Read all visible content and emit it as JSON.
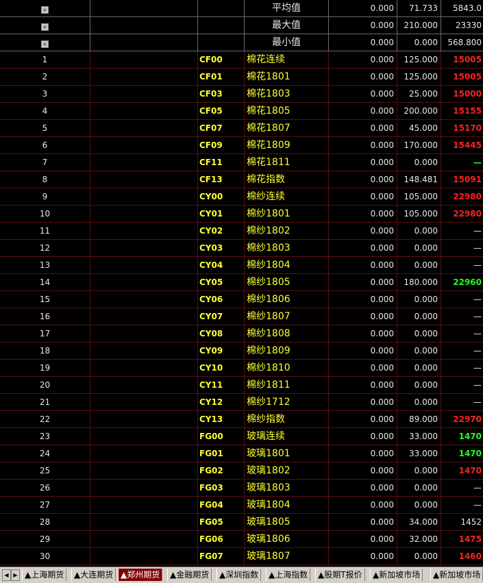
{
  "stats": [
    {
      "label": "平均值",
      "v1": "0.000",
      "v2": "71.733",
      "v3": "5843.0"
    },
    {
      "label": "最大值",
      "v1": "0.000",
      "v2": "210.000",
      "v3": "23330"
    },
    {
      "label": "最小值",
      "v1": "0.000",
      "v2": "0.000",
      "v3": "568.800"
    }
  ],
  "rows": [
    {
      "no": "1",
      "code": "CF00",
      "name": "棉花连续",
      "v1": "0.000",
      "v2": "125.000",
      "v3": "15005",
      "color": "red"
    },
    {
      "no": "2",
      "code": "CF01",
      "name": "棉花1801",
      "v1": "0.000",
      "v2": "125.000",
      "v3": "15005",
      "color": "red"
    },
    {
      "no": "3",
      "code": "CF03",
      "name": "棉花1803",
      "v1": "0.000",
      "v2": "25.000",
      "v3": "15000",
      "color": "red"
    },
    {
      "no": "4",
      "code": "CF05",
      "name": "棉花1805",
      "v1": "0.000",
      "v2": "200.000",
      "v3": "15155",
      "color": "red"
    },
    {
      "no": "5",
      "code": "CF07",
      "name": "棉花1807",
      "v1": "0.000",
      "v2": "45.000",
      "v3": "15170",
      "color": "red"
    },
    {
      "no": "6",
      "code": "CF09",
      "name": "棉花1809",
      "v1": "0.000",
      "v2": "170.000",
      "v3": "15445",
      "color": "red"
    },
    {
      "no": "7",
      "code": "CF11",
      "name": "棉花1811",
      "v1": "0.000",
      "v2": "0.000",
      "v3": "—",
      "color": "green"
    },
    {
      "no": "8",
      "code": "CF13",
      "name": "棉花指数",
      "v1": "0.000",
      "v2": "148.481",
      "v3": "15091",
      "color": "red"
    },
    {
      "no": "9",
      "code": "CY00",
      "name": "棉纱连续",
      "v1": "0.000",
      "v2": "105.000",
      "v3": "22980",
      "color": "red"
    },
    {
      "no": "10",
      "code": "CY01",
      "name": "棉纱1801",
      "v1": "0.000",
      "v2": "105.000",
      "v3": "22980",
      "color": "red"
    },
    {
      "no": "11",
      "code": "CY02",
      "name": "棉纱1802",
      "v1": "0.000",
      "v2": "0.000",
      "v3": "—",
      "color": "white"
    },
    {
      "no": "12",
      "code": "CY03",
      "name": "棉纱1803",
      "v1": "0.000",
      "v2": "0.000",
      "v3": "—",
      "color": "white"
    },
    {
      "no": "13",
      "code": "CY04",
      "name": "棉纱1804",
      "v1": "0.000",
      "v2": "0.000",
      "v3": "—",
      "color": "white"
    },
    {
      "no": "14",
      "code": "CY05",
      "name": "棉纱1805",
      "v1": "0.000",
      "v2": "180.000",
      "v3": "22960",
      "color": "green"
    },
    {
      "no": "15",
      "code": "CY06",
      "name": "棉纱1806",
      "v1": "0.000",
      "v2": "0.000",
      "v3": "—",
      "color": "white"
    },
    {
      "no": "16",
      "code": "CY07",
      "name": "棉纱1807",
      "v1": "0.000",
      "v2": "0.000",
      "v3": "—",
      "color": "white"
    },
    {
      "no": "17",
      "code": "CY08",
      "name": "棉纱1808",
      "v1": "0.000",
      "v2": "0.000",
      "v3": "—",
      "color": "white"
    },
    {
      "no": "18",
      "code": "CY09",
      "name": "棉纱1809",
      "v1": "0.000",
      "v2": "0.000",
      "v3": "—",
      "color": "white"
    },
    {
      "no": "19",
      "code": "CY10",
      "name": "棉纱1810",
      "v1": "0.000",
      "v2": "0.000",
      "v3": "—",
      "color": "white"
    },
    {
      "no": "20",
      "code": "CY11",
      "name": "棉纱1811",
      "v1": "0.000",
      "v2": "0.000",
      "v3": "—",
      "color": "white"
    },
    {
      "no": "21",
      "code": "CY12",
      "name": "棉纱1712",
      "v1": "0.000",
      "v2": "0.000",
      "v3": "—",
      "color": "white"
    },
    {
      "no": "22",
      "code": "CY13",
      "name": "棉纱指数",
      "v1": "0.000",
      "v2": "89.000",
      "v3": "22970",
      "color": "red"
    },
    {
      "no": "23",
      "code": "FG00",
      "name": "玻璃连续",
      "v1": "0.000",
      "v2": "33.000",
      "v3": "1470",
      "color": "green"
    },
    {
      "no": "24",
      "code": "FG01",
      "name": "玻璃1801",
      "v1": "0.000",
      "v2": "33.000",
      "v3": "1470",
      "color": "green"
    },
    {
      "no": "25",
      "code": "FG02",
      "name": "玻璃1802",
      "v1": "0.000",
      "v2": "0.000",
      "v3": "1470",
      "color": "red"
    },
    {
      "no": "26",
      "code": "FG03",
      "name": "玻璃1803",
      "v1": "0.000",
      "v2": "0.000",
      "v3": "—",
      "color": "white"
    },
    {
      "no": "27",
      "code": "FG04",
      "name": "玻璃1804",
      "v1": "0.000",
      "v2": "0.000",
      "v3": "—",
      "color": "white"
    },
    {
      "no": "28",
      "code": "FG05",
      "name": "玻璃1805",
      "v1": "0.000",
      "v2": "34.000",
      "v3": "1452",
      "color": "white"
    },
    {
      "no": "29",
      "code": "FG06",
      "name": "玻璃1806",
      "v1": "0.000",
      "v2": "32.000",
      "v3": "1475",
      "color": "red"
    },
    {
      "no": "30",
      "code": "FG07",
      "name": "玻璃1807",
      "v1": "0.000",
      "v2": "0.000",
      "v3": "1460",
      "color": "red"
    }
  ],
  "tabs": [
    {
      "label": "▲上海期货",
      "active": false
    },
    {
      "label": "▲大连期货",
      "active": false
    },
    {
      "label": "▲郑州期货",
      "active": true
    },
    {
      "label": "▲金融期货",
      "active": false
    },
    {
      "label": "▲深圳指数",
      "active": false
    },
    {
      "label": "▲上海指数",
      "active": false
    },
    {
      "label": "▲股期T报价",
      "active": false
    },
    {
      "label": "▲新加坡市场",
      "active": false
    },
    {
      "label": "▲新加坡市场",
      "active": false
    }
  ],
  "scroll_buttons": {
    "left": "◀",
    "right": "▶"
  },
  "checkbox_glyph": "×",
  "colors": {
    "red": "#ff2020",
    "green": "#20ff20",
    "yellow": "#ffff33",
    "active_tab": "#800000",
    "grid_line": "#5a1010"
  }
}
